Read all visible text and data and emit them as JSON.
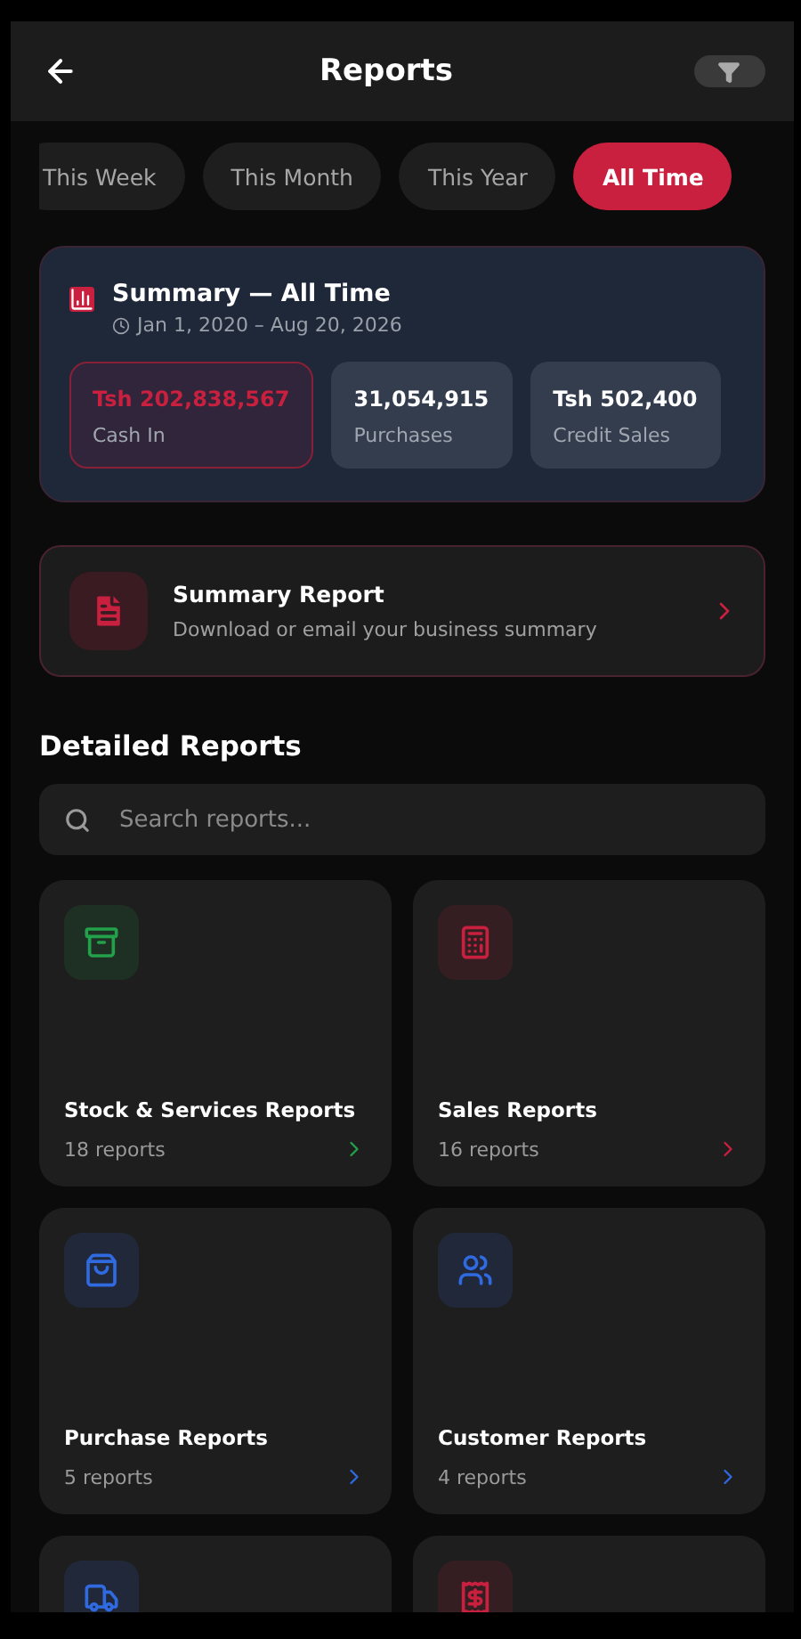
{
  "header": {
    "title": "Reports"
  },
  "periods": [
    {
      "label": "This Week",
      "selected": false
    },
    {
      "label": "This Month",
      "selected": false
    },
    {
      "label": "This Year",
      "selected": false
    },
    {
      "label": "All Time",
      "selected": true
    }
  ],
  "summary": {
    "title": "Summary — All Time",
    "range": "Jan 1, 2020 – Aug 20, 2026",
    "stats": [
      {
        "value": "Tsh 202,838,567",
        "label": "Cash In",
        "selected": true
      },
      {
        "value": "31,054,915",
        "label": "Purchases",
        "selected": false
      },
      {
        "value": "Tsh 502,400",
        "label": "Credit Sales",
        "selected": false
      }
    ]
  },
  "summary_report": {
    "title": "Summary Report",
    "subtitle": "Download or email your business summary"
  },
  "detailed": {
    "heading": "Detailed Reports",
    "search": {
      "placeholder": "Search reports..."
    },
    "categories": [
      {
        "title": "Stock & Services Reports",
        "count": "18 reports",
        "color": "#22a04a"
      },
      {
        "title": "Sales Reports",
        "count": "16 reports",
        "color": "#c8203e"
      },
      {
        "title": "Purchase Reports",
        "count": "5 reports",
        "color": "#2f6ae0"
      },
      {
        "title": "Customer Reports",
        "count": "4 reports",
        "color": "#2f6ae0"
      },
      {
        "color": "#2f6ae0"
      },
      {
        "color": "#c8203e"
      }
    ]
  }
}
